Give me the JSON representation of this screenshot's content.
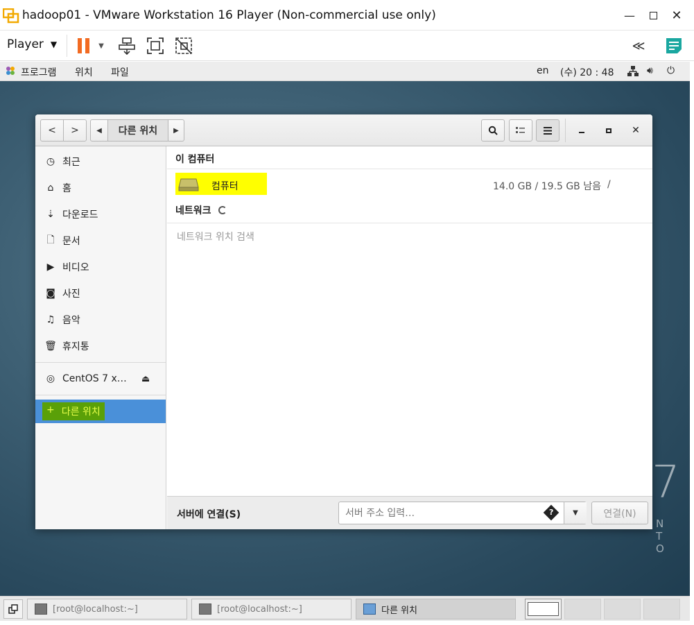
{
  "vmware": {
    "title": "hadoop01 - VMware Workstation 16 Player (Non-commercial use only)",
    "player_menu": "Player"
  },
  "gnome_topbar": {
    "apps_menu": "프로그램",
    "places_menu": "위치",
    "file_menu": "파일",
    "keyboard": "en",
    "clock": "(수) 20 : 48"
  },
  "nautilus": {
    "path_label": "다른 위치",
    "sidebar": {
      "items": [
        {
          "label": "최근",
          "icon": "clock-icon"
        },
        {
          "label": "홈",
          "icon": "home-icon"
        },
        {
          "label": "다운로드",
          "icon": "download-icon"
        },
        {
          "label": "문서",
          "icon": "document-icon"
        },
        {
          "label": "비디오",
          "icon": "video-icon"
        },
        {
          "label": "사진",
          "icon": "camera-icon"
        },
        {
          "label": "음악",
          "icon": "music-icon"
        },
        {
          "label": "휴지통",
          "icon": "trash-icon"
        }
      ],
      "device": "CentOS 7 x…",
      "other_locations": "다른 위치"
    },
    "this_computer_header": "이 컴퓨터",
    "computer_label": "컴퓨터",
    "computer_usage": "14.0 GB / 19.5 GB 남음",
    "computer_mount": "/",
    "network_header": "네트워크",
    "network_status": "네트워크 위치 검색",
    "connect_label": "서버에 연결(S)",
    "server_placeholder": "서버 주소 입력…",
    "connect_button": "연결(N)"
  },
  "taskbar": {
    "tasks": [
      {
        "label": "[root@localhost:~]"
      },
      {
        "label": "[root@localhost:~]"
      },
      {
        "label": "다른 위치"
      }
    ]
  },
  "desktop_brand": {
    "mark": "7",
    "text": "N T O"
  },
  "colors": {
    "selection_blue": "#4a90d9",
    "highlight_yellow": "#ffff00",
    "highlight_green": "#5aa008",
    "pause_orange": "#f26b22",
    "note_teal": "#1aa7a0"
  }
}
